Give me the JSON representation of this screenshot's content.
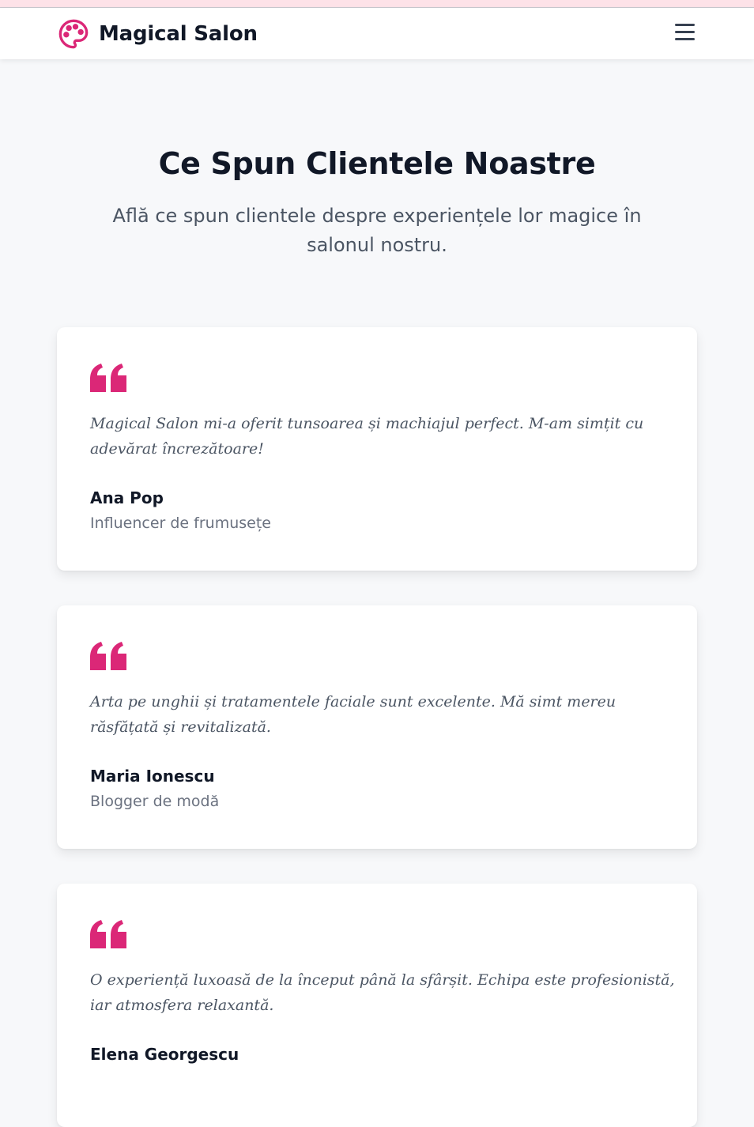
{
  "colors": {
    "accent": "#db2777",
    "heading": "#111827",
    "muted": "#6b7280",
    "background": "#f7f8fa"
  },
  "navbar": {
    "brand_name": "Magical Salon",
    "logo_icon": "palette-icon",
    "menu_icon": "hamburger-menu-icon"
  },
  "testimonials_section": {
    "title": "Ce Spun Clientele Noastre",
    "subtitle": "Află ce spun clientele despre experiențele lor magice în salonul nostru.",
    "items": [
      {
        "quote": "Magical Salon mi-a oferit tunsoarea și machiajul perfect. M-am simțit cu adevărat încrezătoare!",
        "name": "Ana Pop",
        "role": "Influencer de frumusețe"
      },
      {
        "quote": "Arta pe unghii și tratamentele faciale sunt excelente. Mă simt mereu răsfățată și revitalizată.",
        "name": "Maria Ionescu",
        "role": "Blogger de modă"
      },
      {
        "quote": "O experiență luxoasă de la început până la sfârșit. Echipa este profesionistă, iar atmosfera relaxantă.",
        "name": "Elena Georgescu",
        "role": ""
      }
    ]
  }
}
